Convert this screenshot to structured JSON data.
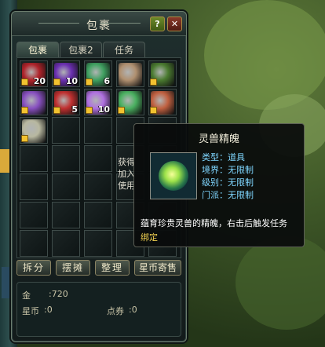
{
  "window": {
    "title": "包裹",
    "help_label": "?",
    "close_label": "✕"
  },
  "tabs": [
    {
      "label": "包裹",
      "active": true
    },
    {
      "label": "包裹2",
      "active": false
    },
    {
      "label": "任务",
      "active": false
    }
  ],
  "items": [
    {
      "name": "red-orb-item",
      "qty": "20",
      "color": "#b0232a",
      "locked": true
    },
    {
      "name": "purple-bag-item",
      "qty": "10",
      "color": "#6a2fb0",
      "locked": true
    },
    {
      "name": "green-orb-item",
      "qty": "6",
      "color": "#3fa060",
      "locked": true
    },
    {
      "name": "robe-item",
      "qty": "",
      "color": "#b09070",
      "locked": false
    },
    {
      "name": "jade-chest-item",
      "qty": "",
      "color": "#4a7a30",
      "locked": true
    },
    {
      "name": "purple-gem-item",
      "qty": "",
      "color": "#8850c0",
      "locked": true
    },
    {
      "name": "red-necklace-item",
      "qty": "5",
      "color": "#c03030",
      "locked": true
    },
    {
      "name": "violet-pearls-item",
      "qty": "10",
      "color": "#b070e0",
      "locked": true
    },
    {
      "name": "spirit-beast-soul-item",
      "qty": "",
      "color": "#4ab060",
      "locked": true
    },
    {
      "name": "figurine-item",
      "qty": "",
      "color": "#c06040",
      "locked": true
    },
    {
      "name": "sword-item",
      "qty": "",
      "color": "#b8b8a0",
      "locked": true
    }
  ],
  "hidden_text": [
    "获得",
    "加入",
    "使用"
  ],
  "actions": {
    "split": "拆分",
    "stall": "摆摊",
    "sort": "整理",
    "star_consign": "星币寄售"
  },
  "currency": {
    "gold_label": "金",
    "gold_value": ":720",
    "star_label": "星币",
    "star_value": ":0",
    "points_label": "点券",
    "points_value": ":0"
  },
  "tooltip": {
    "title": "灵兽精魄",
    "type": "类型：道具",
    "realm": "境界：无限制",
    "level": "级别：无限制",
    "sect": "门派：无限制",
    "description": "蕴育珍贵灵兽的精魄，右击后触发任务",
    "bind": "绑定"
  }
}
